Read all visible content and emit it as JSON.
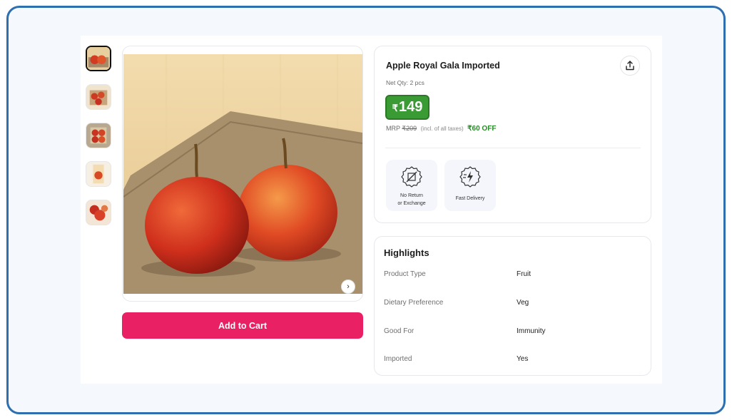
{
  "product": {
    "title": "Apple Royal Gala Imported",
    "net_qty": "Net Qty: 2 pcs",
    "price_symbol": "₹",
    "price_value": "149",
    "mrp_label": "MRP",
    "mrp_value": "₹209",
    "tax_note": "(incl. of all taxes)",
    "discount": "₹60 OFF"
  },
  "features": [
    {
      "line1": "No Return",
      "line2": "or Exchange",
      "icon": "no-return-icon"
    },
    {
      "line1": "Fast Delivery",
      "line2": "",
      "icon": "fast-delivery-icon"
    }
  ],
  "actions": {
    "add_to_cart": "Add to Cart",
    "next_glyph": "›"
  },
  "highlights": {
    "title": "Highlights",
    "rows": [
      {
        "key": "Product Type",
        "value": "Fruit"
      },
      {
        "key": "Dietary Preference",
        "value": "Veg"
      },
      {
        "key": "Good For",
        "value": "Immunity"
      },
      {
        "key": "Imported",
        "value": "Yes"
      }
    ]
  },
  "colors": {
    "frame_border": "#2e6fb0",
    "cart_button": "#ea2065",
    "price_badge": "#3a9a34",
    "discount_text": "#2a8a2a"
  }
}
